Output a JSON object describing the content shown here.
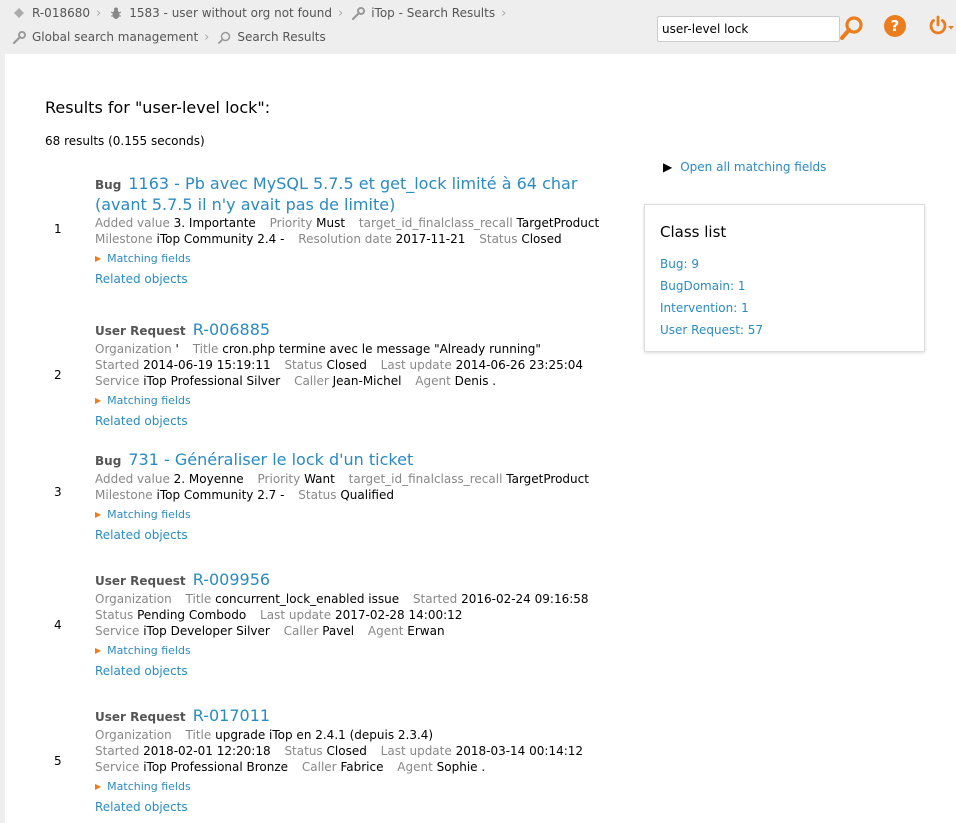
{
  "breadcrumbs": {
    "row1": [
      {
        "label": "R-018680",
        "icon": "diamond-icon"
      },
      {
        "label": "1583 - user without org not found",
        "icon": "bug-icon"
      },
      {
        "label": "iTop - Search Results",
        "icon": "wrench-icon"
      }
    ],
    "row2": [
      {
        "label": "Global search management",
        "icon": "wrench-icon"
      },
      {
        "label": "Search Results",
        "icon": "search-icon"
      }
    ]
  },
  "search": {
    "value": "user-level lock"
  },
  "header": {
    "help_label": "?"
  },
  "colors": {
    "accent": "#ea7d1e",
    "link": "#2a8bc0"
  },
  "main": {
    "title": "Results for \"user-level lock\":",
    "count": "68 results (0.155 seconds)",
    "matching_fields_label": "Matching fields",
    "related_objects_label": "Related objects",
    "results": [
      {
        "rank": "1",
        "class": "Bug",
        "title": "1163 - Pb avec MySQL 5.7.5 et get_lock limité à 64 char (avant 5.7.5 il n'y avait pas de limite)",
        "attrs": [
          {
            "label": "Added value",
            "value": "3. Importante"
          },
          {
            "label": "Priority",
            "value": "Must"
          },
          {
            "label": "target_id_finalclass_recall",
            "value": "TargetProduct"
          },
          {
            "label": "Milestone",
            "value": "iTop Community 2.4 -"
          },
          {
            "label": "Resolution date",
            "value": "2017-11-21"
          },
          {
            "label": "Status",
            "value": "Closed"
          }
        ]
      },
      {
        "rank": "2",
        "class": "User Request",
        "title": "R-006885",
        "attrs": [
          {
            "label": "Organization",
            "value": "'"
          },
          {
            "label": "Title",
            "value": "cron.php termine avec le message \"Already running\""
          },
          {
            "label": "Started",
            "value": "2014-06-19 15:19:11"
          },
          {
            "label": "Status",
            "value": "Closed"
          },
          {
            "label": "Last update",
            "value": "2014-06-26 23:25:04"
          },
          {
            "label": "Service",
            "value": "iTop Professional Silver"
          },
          {
            "label": "Caller",
            "value": "Jean-Michel"
          },
          {
            "label": "Agent",
            "value": "Denis ."
          }
        ]
      },
      {
        "rank": "3",
        "class": "Bug",
        "title": "731 - Généraliser le lock d'un ticket",
        "attrs": [
          {
            "label": "Added value",
            "value": "2. Moyenne"
          },
          {
            "label": "Priority",
            "value": "Want"
          },
          {
            "label": "target_id_finalclass_recall",
            "value": "TargetProduct"
          },
          {
            "label": "Milestone",
            "value": "iTop Community 2.7 -"
          },
          {
            "label": "Status",
            "value": "Qualified"
          }
        ]
      },
      {
        "rank": "4",
        "class": "User Request",
        "title": "R-009956",
        "attrs": [
          {
            "label": "Organization",
            "value": ""
          },
          {
            "label": "Title",
            "value": "concurrent_lock_enabled issue"
          },
          {
            "label": "Started",
            "value": "2016-02-24 09:16:58"
          },
          {
            "label": "Status",
            "value": "Pending Combodo"
          },
          {
            "label": "Last update",
            "value": "2017-02-28 14:00:12"
          },
          {
            "label": "Service",
            "value": "iTop Developer Silver"
          },
          {
            "label": "Caller",
            "value": "Pavel"
          },
          {
            "label": "Agent",
            "value": "Erwan"
          }
        ]
      },
      {
        "rank": "5",
        "class": "User Request",
        "title": "R-017011",
        "attrs": [
          {
            "label": "Organization",
            "value": ""
          },
          {
            "label": "Title",
            "value": "upgrade iTop en 2.4.1 (depuis 2.3.4)"
          },
          {
            "label": "Started",
            "value": "2018-02-01 12:20:18"
          },
          {
            "label": "Status",
            "value": "Closed"
          },
          {
            "label": "Last update",
            "value": "2018-03-14 00:14:12"
          },
          {
            "label": "Service",
            "value": "iTop Professional Bronze"
          },
          {
            "label": "Caller",
            "value": "Fabrice"
          },
          {
            "label": "Agent",
            "value": "Sophie ."
          }
        ]
      }
    ]
  },
  "sidebar": {
    "open_all": "Open all matching fields",
    "class_list_title": "Class list",
    "classes": [
      "Bug: 9",
      "BugDomain: 1",
      "Intervention: 1",
      "User Request: 57"
    ]
  }
}
